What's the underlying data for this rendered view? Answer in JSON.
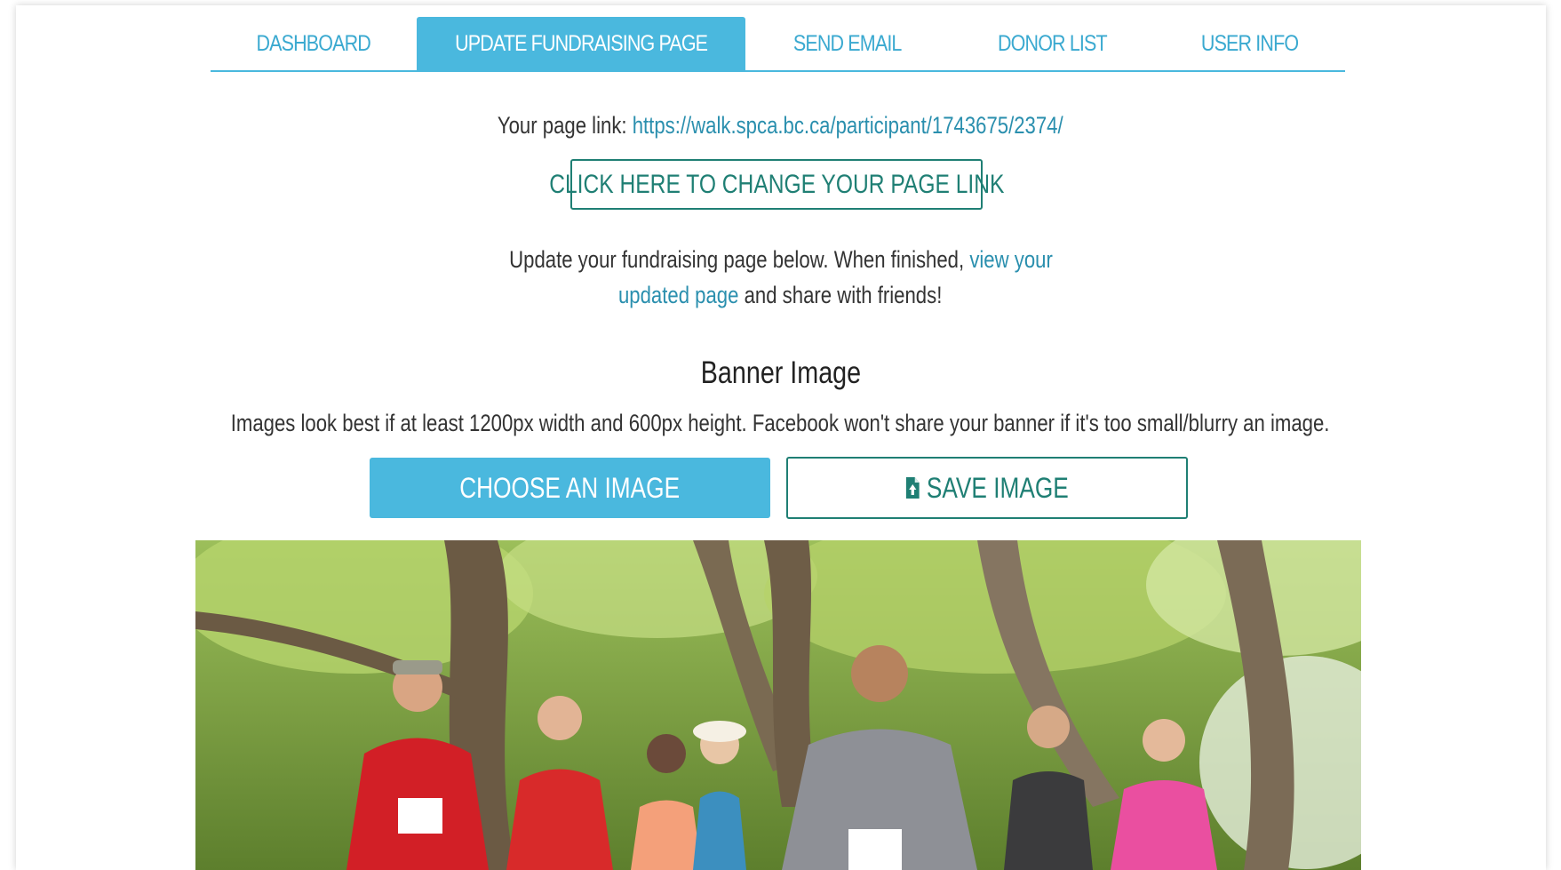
{
  "tabs": [
    {
      "label": "DASHBOARD",
      "active": false
    },
    {
      "label": "UPDATE FUNDRAISING PAGE",
      "active": true
    },
    {
      "label": "SEND EMAIL",
      "active": false
    },
    {
      "label": "DONOR LIST",
      "active": false
    },
    {
      "label": "USER INFO",
      "active": false
    }
  ],
  "page_link": {
    "prefix": "Your page link:",
    "url": "https://walk.spca.bc.ca/participant/1743675/2374/"
  },
  "change_link_button": "CLICK HERE TO CHANGE YOUR PAGE LINK",
  "instructions": {
    "before": "Update your fundraising page below. When finished,",
    "link_part1": "view your",
    "link_part2": "updated page",
    "after": "and share with friends!"
  },
  "banner": {
    "title": "Banner Image",
    "hint": "Images look best if at least 1200px width and 600px height. Facebook won't share your banner if it's too small/blurry an image.",
    "choose_button": "CHOOSE AN IMAGE",
    "save_button": "SAVE IMAGE",
    "save_icon": "file-upload-icon"
  },
  "colors": {
    "accent": "#4ab8de",
    "tab_text": "#3aa9d0",
    "link": "#2a8fae",
    "button_outline": "#1f7f74"
  }
}
